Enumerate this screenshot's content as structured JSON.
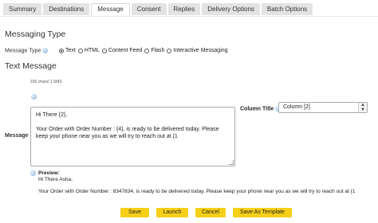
{
  "tabs": [
    {
      "label": "Summary",
      "active": false
    },
    {
      "label": "Destinations",
      "active": false
    },
    {
      "label": "Message",
      "active": true
    },
    {
      "label": "Consent",
      "active": false
    },
    {
      "label": "Replies",
      "active": false
    },
    {
      "label": "Delivery Options",
      "active": false
    },
    {
      "label": "Batch Options",
      "active": false
    }
  ],
  "section_title": "Messaging Type",
  "message_type": {
    "label": "Message Type",
    "options": [
      {
        "label": "Text",
        "selected": true
      },
      {
        "label": "HTML",
        "selected": false
      },
      {
        "label": "Content Feed",
        "selected": false
      },
      {
        "label": "Flash",
        "selected": false
      },
      {
        "label": "Interactive Messaging",
        "selected": false
      }
    ]
  },
  "text_message": {
    "title": "Text Message",
    "char_count": "156 chars/ 1 SMS",
    "field_label": "Message",
    "lines": [
      "Hi There {2},",
      "Your Order with Order Number : {4}, is ready to be delivered today. Please keep your phone near you as we will try to reach out at {1"
    ]
  },
  "column_title": {
    "label": "Column Title",
    "selected": "Column [2]"
  },
  "preview": {
    "label": "Preview:",
    "greeting": "Hi There Asha,",
    "body": "Your Order with Order Number : 8347834, is ready to be delivered today. Please keep your phone near you as we will try to reach out at {1"
  },
  "buttons": {
    "save": "Save",
    "launch": "Launch",
    "cancel": "Cancel",
    "save_as_template": "Save As Template"
  },
  "colors": {
    "button": "#f6cf19",
    "tab": "#e3e3e3",
    "info_icon": "#aac9e6"
  }
}
